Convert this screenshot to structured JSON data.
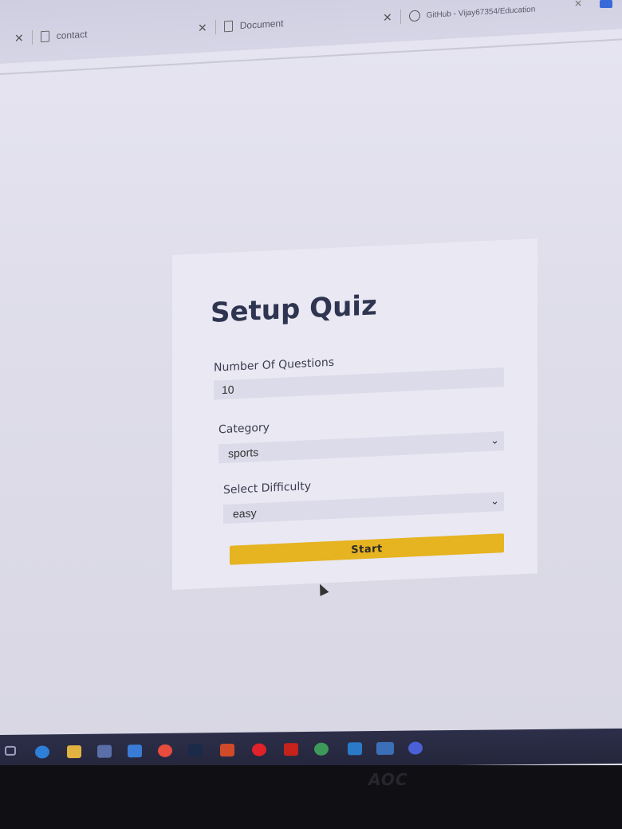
{
  "browser": {
    "tabs": [
      {
        "label": "contact"
      },
      {
        "label": "Document"
      },
      {
        "label": "GitHub - Vijay67354/Education"
      }
    ]
  },
  "quiz": {
    "title": "Setup Quiz",
    "questions_label": "Number Of Questions",
    "questions_value": "10",
    "category_label": "Category",
    "category_value": "sports",
    "difficulty_label": "Select Difficulty",
    "difficulty_value": "easy",
    "start_label": "Start",
    "accent_color": "#e6b321"
  },
  "taskbar": {
    "icons": [
      "task-view-icon",
      "edge-icon",
      "file-explorer-icon",
      "store-icon",
      "mail-icon",
      "chrome-icon",
      "photoshop-icon",
      "powerpoint-icon",
      "opera-icon",
      "acrobat-icon",
      "chrome-alt-icon",
      "vscode-icon",
      "photos-icon",
      "github-desktop-icon"
    ]
  },
  "monitor": {
    "brand": "AOC"
  }
}
